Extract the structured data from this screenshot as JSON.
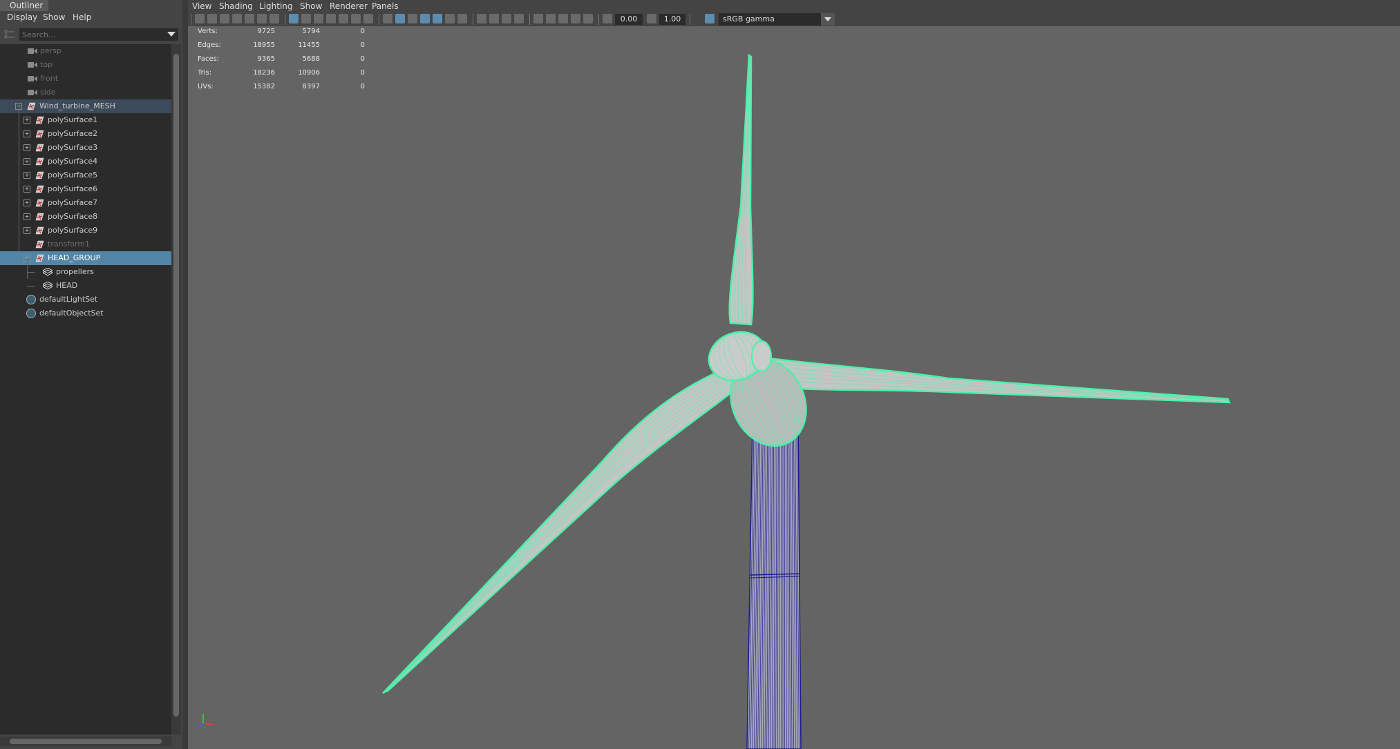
{
  "outliner": {
    "tab_title": "Outliner",
    "menu": [
      "Display",
      "Show",
      "Help"
    ],
    "search_placeholder": "Search...",
    "items": [
      {
        "label": "persp",
        "type": "camera",
        "state": "dim"
      },
      {
        "label": "top",
        "type": "camera",
        "state": "dim"
      },
      {
        "label": "front",
        "type": "camera",
        "state": "dim"
      },
      {
        "label": "side",
        "type": "camera",
        "state": "dim"
      },
      {
        "label": "Wind_turbine_MESH",
        "type": "mesh",
        "state": "highlighted",
        "expanded": true
      },
      {
        "label": "polySurface1",
        "type": "mesh",
        "state": "normal"
      },
      {
        "label": "polySurface2",
        "type": "mesh",
        "state": "normal"
      },
      {
        "label": "polySurface3",
        "type": "mesh",
        "state": "normal"
      },
      {
        "label": "polySurface4",
        "type": "mesh",
        "state": "normal"
      },
      {
        "label": "polySurface5",
        "type": "mesh",
        "state": "normal"
      },
      {
        "label": "polySurface6",
        "type": "mesh",
        "state": "normal"
      },
      {
        "label": "polySurface7",
        "type": "mesh",
        "state": "normal"
      },
      {
        "label": "polySurface8",
        "type": "mesh",
        "state": "normal"
      },
      {
        "label": "polySurface9",
        "type": "mesh",
        "state": "normal"
      },
      {
        "label": "transform1",
        "type": "mesh",
        "state": "dim"
      },
      {
        "label": "HEAD_GROUP",
        "type": "mesh",
        "state": "selected",
        "expanded": true
      },
      {
        "label": "propellers",
        "type": "group",
        "state": "normal"
      },
      {
        "label": "HEAD",
        "type": "group",
        "state": "normal"
      },
      {
        "label": "defaultLightSet",
        "type": "set",
        "state": "normal"
      },
      {
        "label": "defaultObjectSet",
        "type": "set",
        "state": "normal"
      }
    ]
  },
  "viewport": {
    "menu": [
      "View",
      "Shading",
      "Lighting",
      "Show",
      "Renderer",
      "Panels"
    ],
    "exposure": "0.00",
    "gamma": "1.00",
    "color_space": "sRGB gamma"
  },
  "hud": {
    "rows": [
      {
        "label": "Verts:",
        "total": "9725",
        "selected": "5794",
        "components": "0"
      },
      {
        "label": "Edges:",
        "total": "18955",
        "selected": "11455",
        "components": "0"
      },
      {
        "label": "Faces:",
        "total": "9365",
        "selected": "5688",
        "components": "0"
      },
      {
        "label": "Tris:",
        "total": "18236",
        "selected": "10906",
        "components": "0"
      },
      {
        "label": "UVs:",
        "total": "15382",
        "selected": "8397",
        "components": "0"
      }
    ]
  },
  "colors": {
    "selection_highlight": "#4cf0a8",
    "tower_wire": "#1a1a8c",
    "viewport_bg": "#646464",
    "outliner_selected": "#5285a6"
  }
}
